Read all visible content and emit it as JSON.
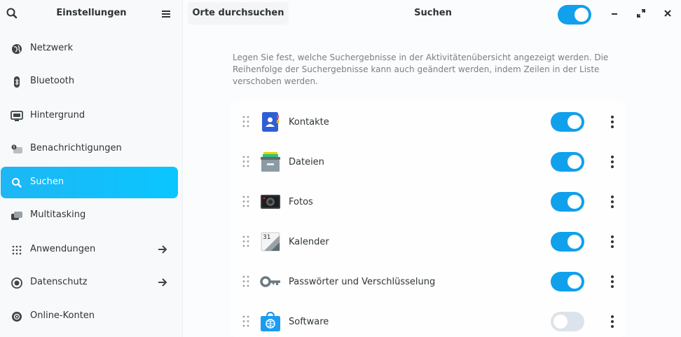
{
  "sidebar": {
    "title": "Einstellungen",
    "items": [
      {
        "label": "Netzwerk",
        "icon": "network-icon",
        "active": false,
        "arrow": false
      },
      {
        "label": "Bluetooth",
        "icon": "bluetooth-icon",
        "active": false,
        "arrow": false
      },
      {
        "label": "Hintergrund",
        "icon": "display-icon",
        "active": false,
        "arrow": false
      },
      {
        "label": "Benachrichtigungen",
        "icon": "notification-icon",
        "active": false,
        "arrow": false
      },
      {
        "label": "Suchen",
        "icon": "search-icon",
        "active": true,
        "arrow": false
      },
      {
        "label": "Multitasking",
        "icon": "multitasking-icon",
        "active": false,
        "arrow": false
      },
      {
        "label": "Anwendungen",
        "icon": "apps-grid-icon",
        "active": false,
        "arrow": true
      },
      {
        "label": "Datenschutz",
        "icon": "privacy-icon",
        "active": false,
        "arrow": true
      },
      {
        "label": "Online-Konten",
        "icon": "online-accounts-icon",
        "active": false,
        "arrow": false
      }
    ]
  },
  "header": {
    "tab_label": "Orte durchsuchen",
    "title": "Suchen",
    "search_enabled": true
  },
  "description": "Legen Sie fest, welche Suchergebnisse in der Aktivitätenübersicht angezeigt werden. Die Reihenfolge der Suchergebnisse kann auch geändert werden, indem Zeilen in der Liste verschoben werden.",
  "providers": [
    {
      "name": "Kontakte",
      "icon": "contacts-icon",
      "enabled": true
    },
    {
      "name": "Dateien",
      "icon": "files-icon",
      "enabled": true
    },
    {
      "name": "Fotos",
      "icon": "photos-icon",
      "enabled": true
    },
    {
      "name": "Kalender",
      "icon": "calendar-icon",
      "enabled": true,
      "icon_text": "31"
    },
    {
      "name": "Passwörter und Verschlüsselung",
      "icon": "key-icon",
      "enabled": true
    },
    {
      "name": "Software",
      "icon": "software-icon",
      "enabled": false
    }
  ],
  "colors": {
    "accent": "#10a0ec",
    "active_item": "#0ec0ff"
  }
}
